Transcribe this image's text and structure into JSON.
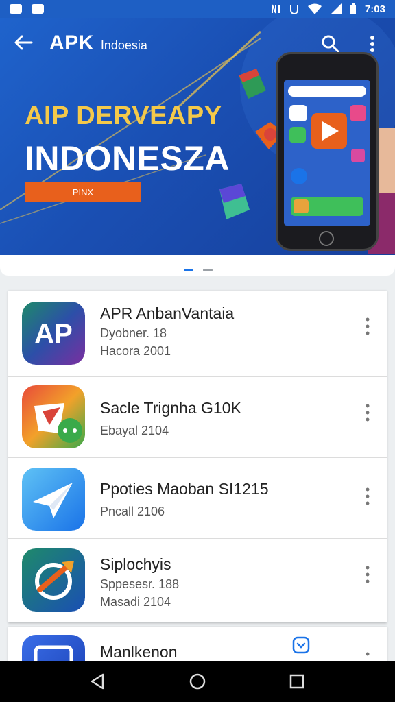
{
  "status_bar": {
    "time": "7:03",
    "icons": [
      "notification-icon",
      "video-icon",
      "nfc-icon",
      "alarm-icon",
      "wifi-icon",
      "signal-icon",
      "battery-icon"
    ]
  },
  "header": {
    "brand_main": "APK",
    "brand_sub": "Indoesia"
  },
  "banner": {
    "headline_line1": "AIP DERVEAPY",
    "headline_line2": "INDONESZA",
    "cta_label": "PINX"
  },
  "carousel": {
    "pages": 2,
    "active": 1
  },
  "apps": [
    {
      "name": "APR AnbanVantaia",
      "meta1": "Dyobner. 18",
      "meta2": "Hacora 2001",
      "icon": "ap-logo-icon"
    },
    {
      "name": "Sacle Trignha G10K",
      "meta1": "Ebayal 2104",
      "meta2": "",
      "icon": "video-message-icon"
    },
    {
      "name": "Ppoties Maoban SI1215",
      "meta1": "Pncall 2106",
      "meta2": "",
      "icon": "paper-plane-icon"
    },
    {
      "name": "Siplochyis",
      "meta1": "Sppesesr. 188",
      "meta2": "Masadi 2104",
      "icon": "refresh-arrow-icon"
    },
    {
      "name": "Manlkenon",
      "meta1": "",
      "meta2": "",
      "icon": "tv-icon"
    }
  ],
  "colors": {
    "banner_blue": "#1f63cc",
    "headline_yellow": "#f4c94a",
    "cta_orange": "#e8601c",
    "accent_blue": "#1a73e8"
  }
}
